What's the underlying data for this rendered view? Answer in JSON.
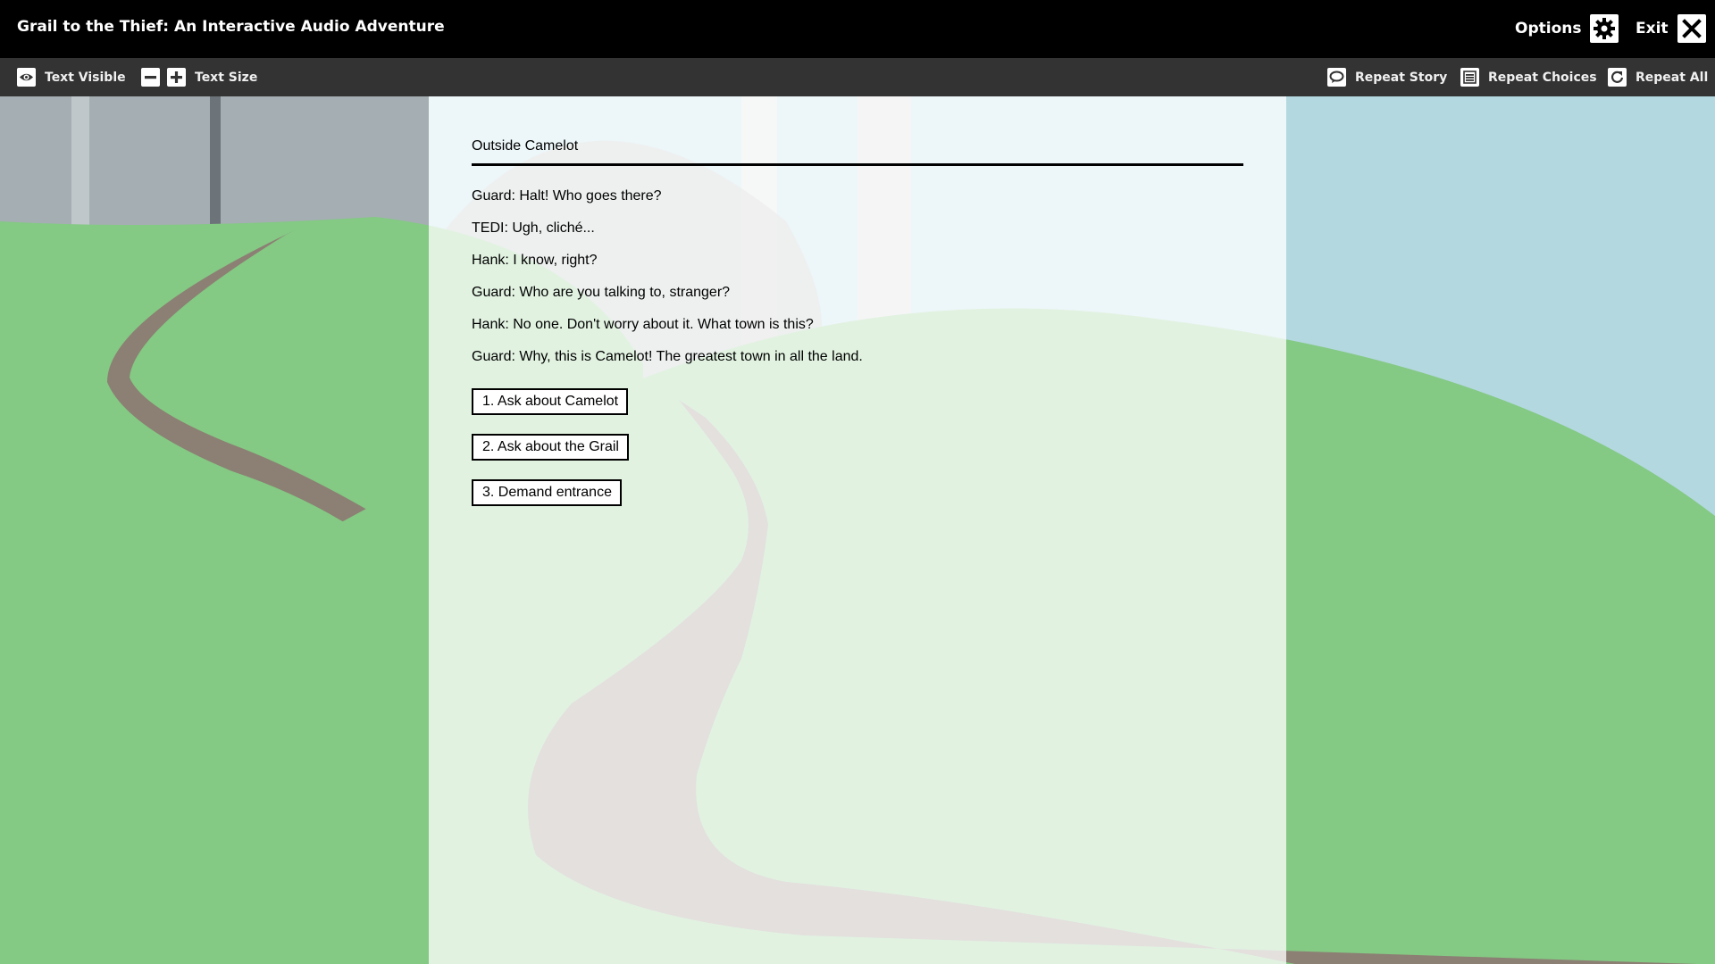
{
  "window": {
    "title": "Grail to the Thief: An Interactive Audio Adventure",
    "options_label": "Options",
    "exit_label": "Exit"
  },
  "toolbar": {
    "text_visible_label": "Text Visible",
    "text_size_label": "Text Size",
    "repeat_story_label": "Repeat Story",
    "repeat_choices_label": "Repeat Choices",
    "repeat_all_label": "Repeat All",
    "icons": [
      "eye-icon",
      "minus-icon",
      "plus-icon",
      "speech-bubble-icon",
      "list-icon",
      "refresh-icon",
      "gear-icon",
      "close-icon"
    ]
  },
  "story": {
    "location": "Outside Camelot",
    "lines": [
      "Guard: Halt! Who goes there?",
      "TEDI: Ugh, cliché...",
      "Hank: I know, right?",
      "Guard: Who are you talking to, stranger?",
      "Hank: No one. Don't worry about it. What town is this?",
      "Guard: Why, this is Camelot! The greatest town in all the land."
    ],
    "choices": [
      "1. Ask about Camelot",
      "2. Ask about the Grail",
      "3. Demand entrance"
    ]
  },
  "colors": {
    "title_bar": "#000000",
    "toolbar": "#333333",
    "sky": "#b3d8e0",
    "hill": "#84c984",
    "road": "#8c7f73"
  }
}
